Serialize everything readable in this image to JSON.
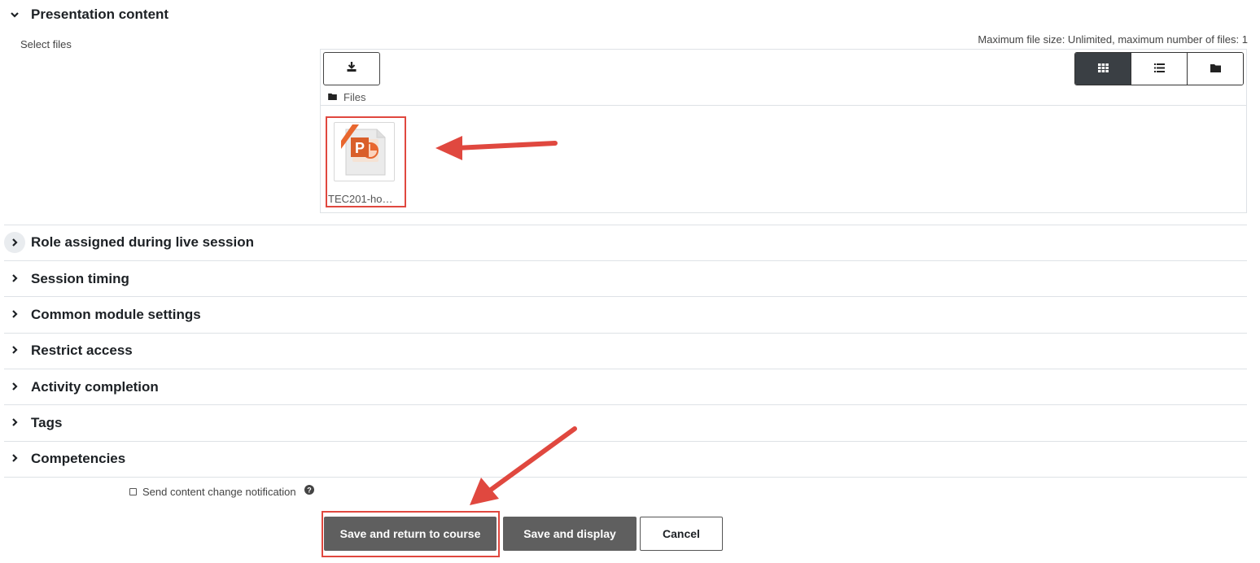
{
  "sections": {
    "presentation": {
      "title": "Presentation content",
      "expanded": true
    },
    "role": {
      "title": "Role assigned during live session"
    },
    "timing": {
      "title": "Session timing"
    },
    "common": {
      "title": "Common module settings"
    },
    "restrict": {
      "title": "Restrict access"
    },
    "completion": {
      "title": "Activity completion"
    },
    "tags": {
      "title": "Tags"
    },
    "competencies": {
      "title": "Competencies"
    }
  },
  "filepicker": {
    "select_label": "Select files",
    "limits_text": "Maximum file size: Unlimited, maximum number of files: 1",
    "path_label": "Files",
    "file": {
      "name": "TEC201-ho…",
      "icon": "powerpoint-file-icon"
    },
    "views": [
      "grid-view-icon",
      "list-view-icon",
      "folder-tree-view-icon"
    ],
    "active_view": "grid"
  },
  "notification": {
    "label": "Send content change notification",
    "checked": false
  },
  "buttons": {
    "save_return": "Save and return to course",
    "save_display": "Save and display",
    "cancel": "Cancel"
  },
  "colors": {
    "annotation_red": "#e0483f",
    "button_dark": "#5f5f5f",
    "view_active": "#3a3f44",
    "ppt_orange": "#e8672f"
  }
}
